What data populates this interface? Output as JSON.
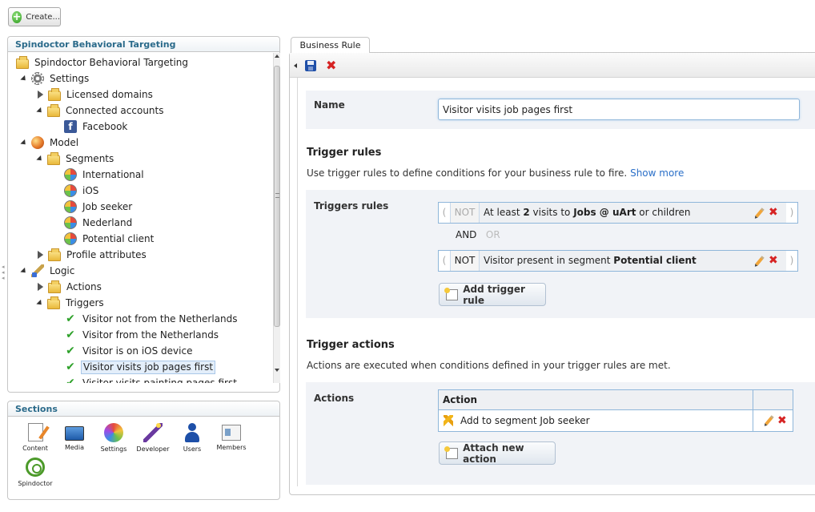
{
  "toolbar": {
    "create_label": "Create..."
  },
  "tree": {
    "title": "Spindoctor Behavioral Targeting",
    "items": [
      {
        "label": "Spindoctor Behavioral Targeting"
      },
      {
        "label": "Settings"
      },
      {
        "label": "Licensed domains"
      },
      {
        "label": "Connected accounts"
      },
      {
        "label": "Facebook"
      },
      {
        "label": "Model"
      },
      {
        "label": "Segments"
      },
      {
        "label": "International"
      },
      {
        "label": "iOS"
      },
      {
        "label": "Job seeker"
      },
      {
        "label": "Nederland"
      },
      {
        "label": "Potential client"
      },
      {
        "label": "Profile attributes"
      },
      {
        "label": "Logic"
      },
      {
        "label": "Actions"
      },
      {
        "label": "Triggers"
      },
      {
        "label": "Visitor not from the Netherlands"
      },
      {
        "label": "Visitor from the Netherlands"
      },
      {
        "label": "Visitor is on iOS device"
      },
      {
        "label": "Visitor visits job pages first"
      },
      {
        "label": "Visitor visits painting pages first"
      }
    ]
  },
  "sections": {
    "title": "Sections",
    "items": [
      {
        "label": "Content",
        "icon": "content-icon"
      },
      {
        "label": "Media",
        "icon": "media-icon"
      },
      {
        "label": "Settings",
        "icon": "settings-icon"
      },
      {
        "label": "Developer",
        "icon": "developer-icon"
      },
      {
        "label": "Users",
        "icon": "users-icon"
      },
      {
        "label": "Members",
        "icon": "members-icon"
      },
      {
        "label": "Spindoctor",
        "icon": "spindoctor-icon"
      }
    ]
  },
  "editor": {
    "tab_label": "Business Rule",
    "name_label": "Name",
    "name_value": "Visitor visits job pages first",
    "trigger_rules_heading": "Trigger rules",
    "trigger_rules_desc": "Use trigger rules to define conditions for your business rule to fire.",
    "show_more": "Show more",
    "triggers_label": "Triggers rules",
    "rules": [
      {
        "paren_open": "(",
        "not": "NOT",
        "text_pre": "At least ",
        "text_bold1": "2",
        "text_mid": " visits to ",
        "text_bold2": "Jobs @ uArt",
        "text_post": " or children",
        "paren_close": ")"
      },
      {
        "paren_open": "(",
        "not": "NOT",
        "text_pre": "Visitor present in segment ",
        "text_bold1": "Potential client",
        "paren_close": ")"
      }
    ],
    "and_label": "AND",
    "or_label": "OR",
    "add_trigger_label": "Add trigger rule",
    "trigger_actions_heading": "Trigger actions",
    "trigger_actions_desc": "Actions are executed when conditions defined in your trigger rules are met.",
    "actions_label": "Actions",
    "actions_table": {
      "header": "Action",
      "rows": [
        {
          "text": "Add to segment Job seeker"
        }
      ]
    },
    "attach_action_label": "Attach new action"
  },
  "colors": {
    "accent": "#2a6fc8",
    "delete": "#d62323",
    "check": "#2ea12a",
    "panel_title": "#2a6a8a"
  }
}
